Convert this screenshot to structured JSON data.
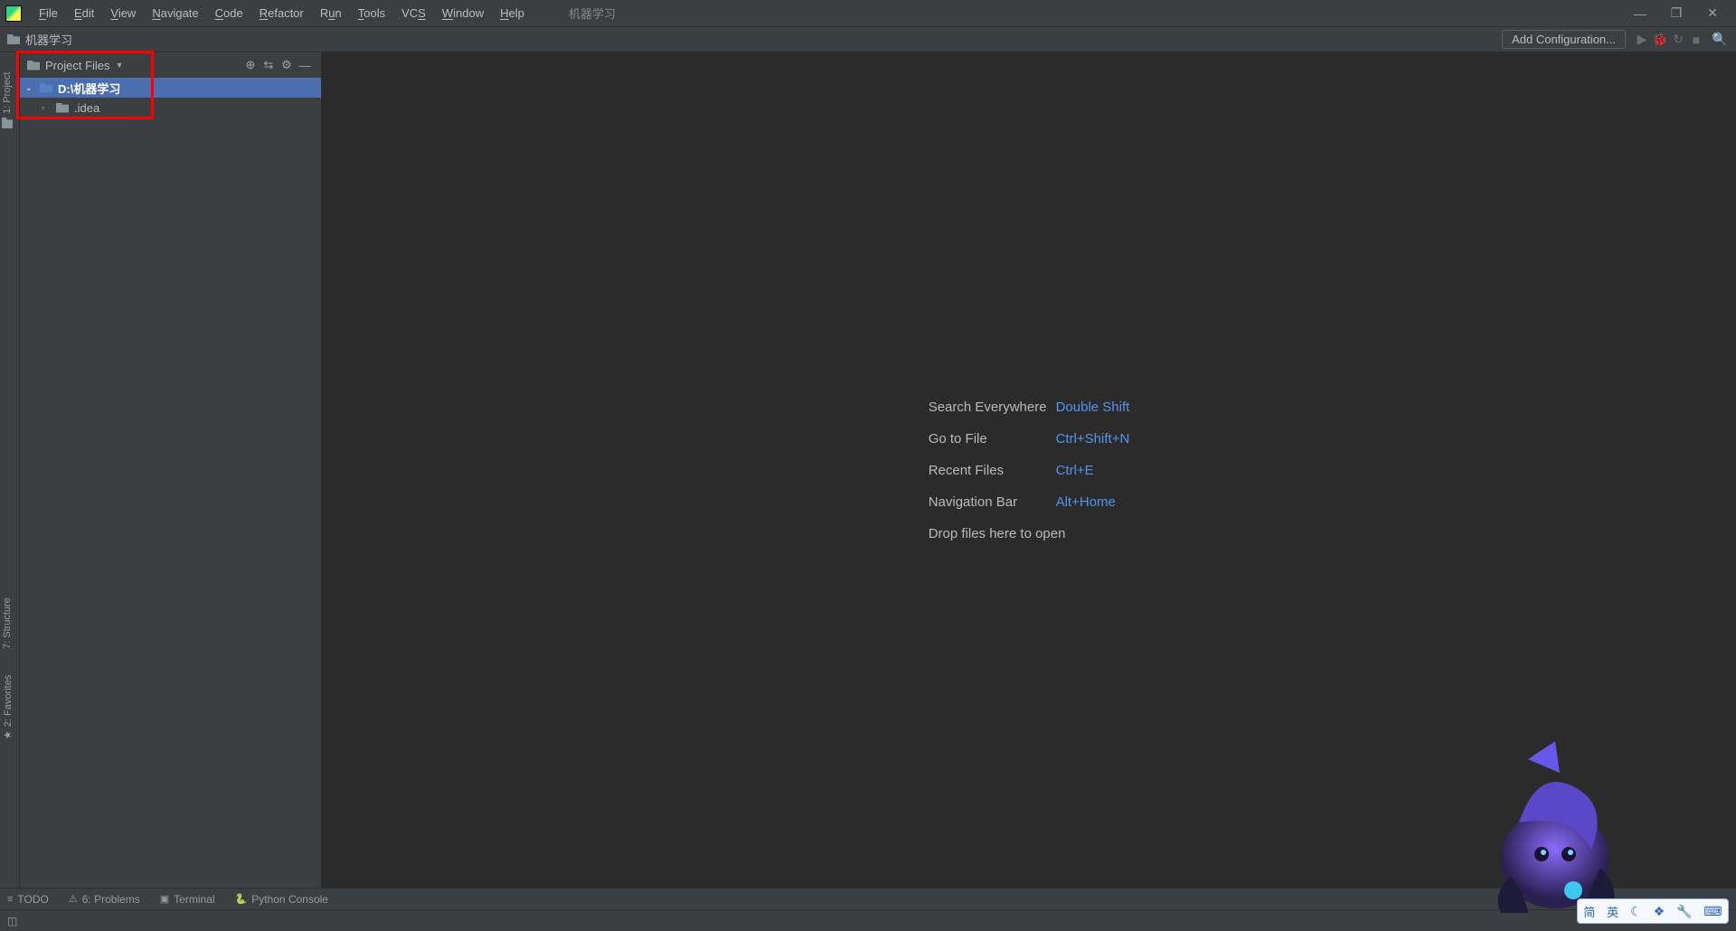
{
  "app": {
    "title": "机器学习"
  },
  "menu": {
    "file": "File",
    "edit": "Edit",
    "view": "View",
    "navigate": "Navigate",
    "code": "Code",
    "refactor": "Refactor",
    "run": "Run",
    "tools": "Tools",
    "vcs": "VCS",
    "window": "Window",
    "help": "Help"
  },
  "breadcrumb": {
    "project": "机器学习"
  },
  "toolbar": {
    "add_config": "Add Configuration..."
  },
  "project_panel": {
    "title": "Project Files",
    "root": "D:\\机器学习",
    "child": ".idea"
  },
  "left_gutter": {
    "project": "1: Project",
    "structure": "7: Structure",
    "favorites": "2: Favorites"
  },
  "hints": {
    "search_label": "Search Everywhere",
    "search_key": "Double Shift",
    "goto_label": "Go to File",
    "goto_key": "Ctrl+Shift+N",
    "recent_label": "Recent Files",
    "recent_key": "Ctrl+E",
    "nav_label": "Navigation Bar",
    "nav_key": "Alt+Home",
    "drop": "Drop files here to open"
  },
  "toolwin": {
    "todo": "TODO",
    "problems": "6: Problems",
    "terminal": "Terminal",
    "pyconsole": "Python Console"
  },
  "ime": {
    "jian": "简",
    "ying": "英"
  }
}
